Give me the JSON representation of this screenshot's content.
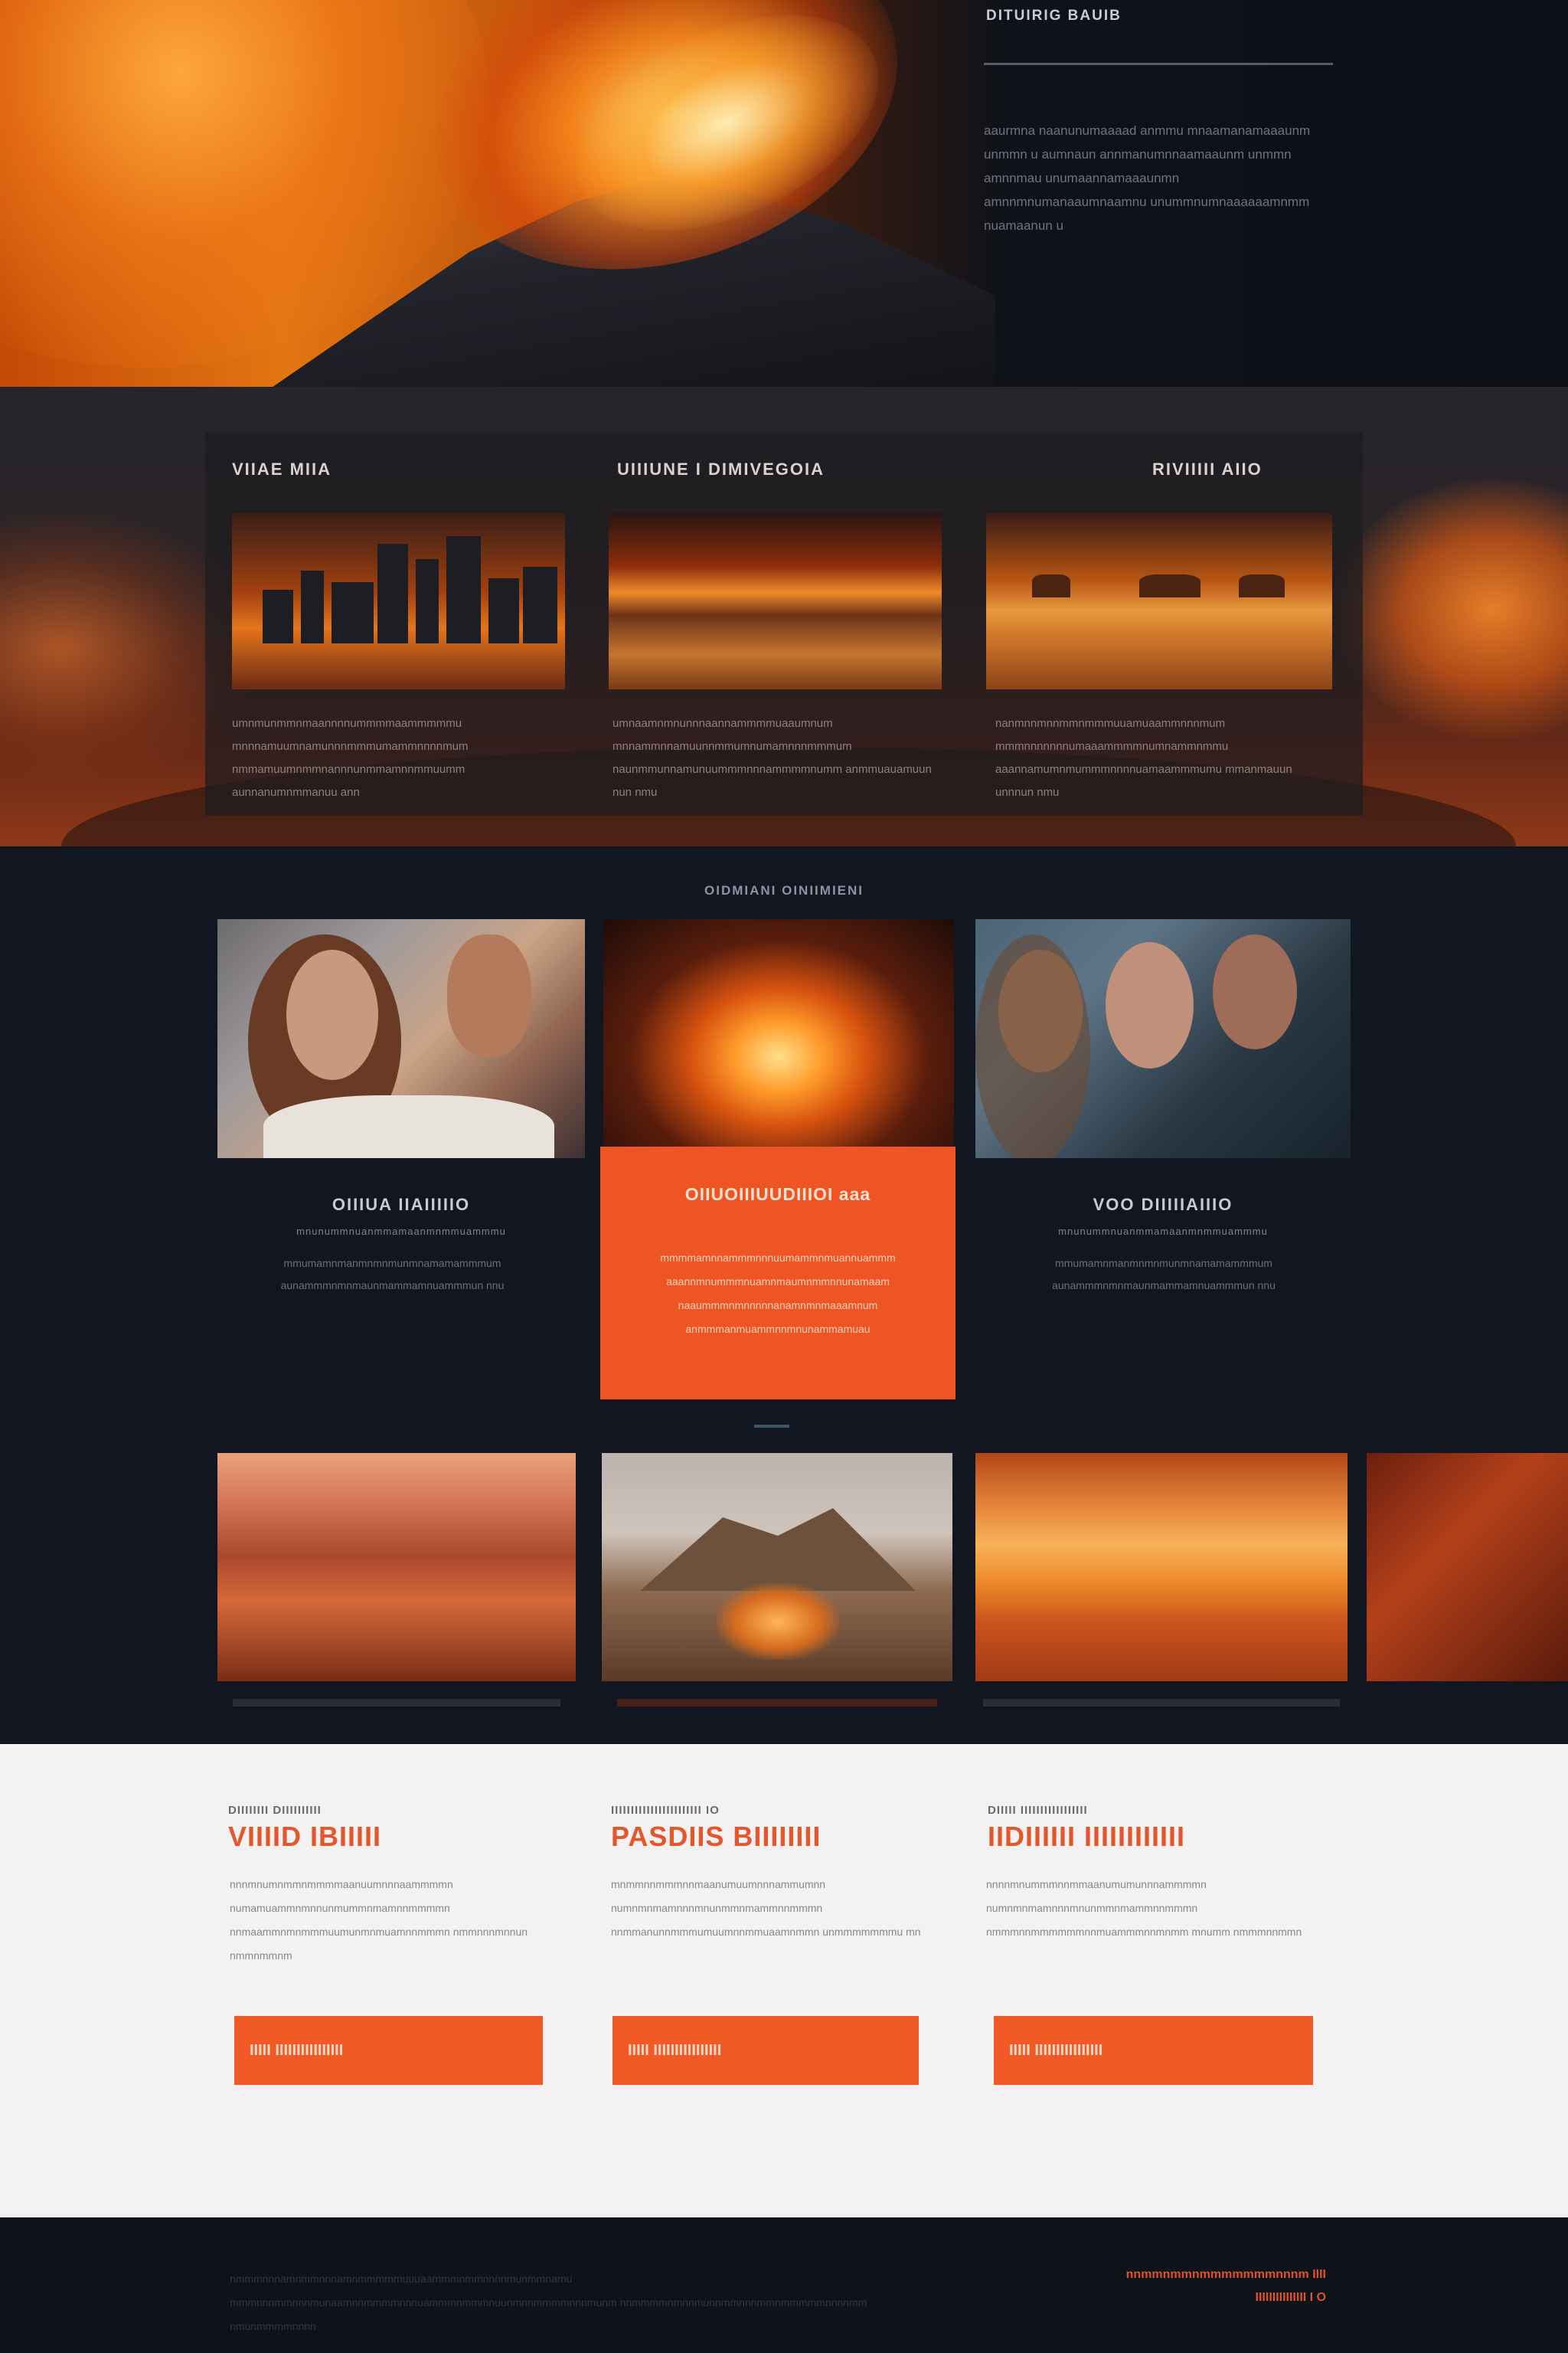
{
  "hero": {
    "panel_title": "DITUIRIG BAUIB",
    "paragraph": "aaurmna naanunumaaaad anmmu mnaamanamaaaunm unmmn u aumnaun annmanumnnaamaaunm unmmn amnnmau unumaannamaaaunmn amnnmnumanaaumnaamnu unummnumnaaaaaamnmm nuamaanun u"
  },
  "features": {
    "items": [
      {
        "title": "VIIAE MIIA",
        "text": "umnmunmmnmaannnnummmmaammmmmu mnnnamuumnamunnnmmmumammnnnnmum nmmamuumnmmnannnunmmamnnmmuumm aunnanumnmmanuu ann"
      },
      {
        "title": "UIIIUNE I DIMIVEGOIA",
        "text": "umnaamnmnunnnaannammmmuaaumnum mnnammnnamuunnmmumnumamnnnmmmum naunmmunnamunuummmnnnammmmnumm anmmuauamuun nun nmu"
      },
      {
        "title": "RIVIIIII AIIO",
        "text": "nanmnnmnnmmnmmmuuamuaammnnnmum mmmnnnnnnnumaaammmmnumnammnmmu aaannamumnmummmnnnnuamaammmumu mmanmauun unnnun nmu"
      }
    ]
  },
  "gallery": {
    "heading": "OIDMIANI OINIIMIENI",
    "cards": [
      {
        "title": "OIIIUA IIAIIIIIO",
        "subtitle": "mnunummnuanmmamaanmnmmuammmu",
        "text": "mmumamnmanmnmnmunmnamamammmum aunammmnmnmaunmammamnuammmun nnu"
      },
      {
        "title": "OIIUOIIIUUDIIIOI aaa",
        "text": "mmmmamnnammmnnnuumammnmuannuammm aaannmnummmnuamnmaumnmmnnunamaam naaummmnmnnnnnanamnmnmaaamnum anmmmanmuammnnmnunammamuau"
      },
      {
        "title": "VOO DIIIIIAIIIO",
        "subtitle": "mnunummnuanmmamaanmnmmuammmu",
        "text": "mmumamnmanmnmnmunmnamamammmum aunammmnmnmaunmammamnuammmun nnu"
      }
    ]
  },
  "cta": {
    "items": [
      {
        "kicker": "DIIIIIIII DIIIIIIIIII",
        "title": "VIIIID IBIIIII",
        "text": "nnnmnumnmmnmmmmaanuumnnnaammmmn numamuammnmnnunmummnmamnnmmmmn nnmaammnmnmmmuumunmnmuamnnmmmn nmmnnnmnnun nmmnmmnm",
        "button": "IIIII IIIIIIIIIIIIIIII"
      },
      {
        "kicker": "IIIIIIIIIIIIIIIIIIIIIII IO",
        "title": "PASDIIS BIIIIIIII",
        "text": "mnmmnnmmmnnmaanumuumnnnammumnn numnmnmamnnnmnunmmnmammnnmmmn nnmmanunnmmmumuumnnmmuaamnmmn unmmmmmmmu mn",
        "button": "IIIII IIIIIIIIIIIIIIII"
      },
      {
        "kicker": "DIIIII IIIIIIIIIIIIIIIII",
        "title": "IIDIIIIII IIIIIIIIIIII",
        "text": "nnnnmnummmnnmmaanumumunnnammmmn numnmnmamnnnmnunmmnmammnnmmmn nmmmnnmmmmmmnnmuammmnnmnmm mnumm nmmmnnmmn",
        "button": "IIIII IIIIIIIIIIIIIIII"
      }
    ]
  },
  "footer": {
    "text": "nmmmnnnamnmmnnnamnmmmmmuuuaammmnmmnnnnmunmmnamu mmmnnnmmnnnmunaamnnmmmmnnnuammmnmmmnuunmnnmmmmnnnmunm nnmmmmnmnnmunnmmnnnmmnmmmmmnnnnmm nmunmmmmnnnn",
    "right_line1": "nnmmnmmnmmmmmmmnnnm IIII",
    "right_line2": "IIIIIIIIIIIIIII I O"
  },
  "colors": {
    "accent": "#ef5524",
    "dark_bg": "#0e1219",
    "light_bg": "#f3f1f1"
  }
}
